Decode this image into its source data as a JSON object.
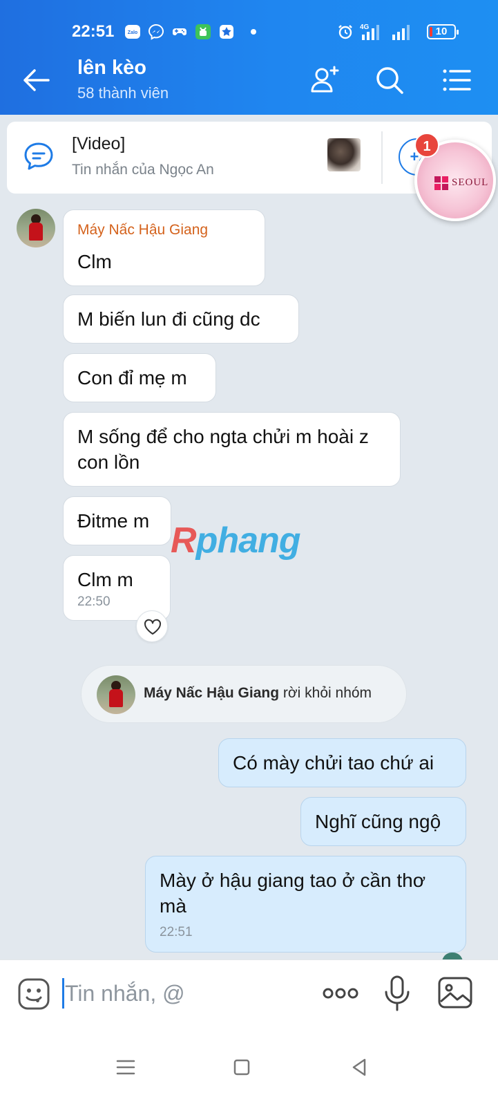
{
  "status_bar": {
    "time": "22:51",
    "battery": "10",
    "network": "4G"
  },
  "header": {
    "title": "lên kèo",
    "subtitle": "58 thành viên"
  },
  "pinned": {
    "title": "[Video]",
    "subtitle": "Tin nhắn của Ngọc An",
    "more_label": "+2",
    "badge": "1",
    "ad_brand": "SEOUL"
  },
  "messages": [
    {
      "sender": "Máy Nấc Hậu Giang",
      "text": "Clm"
    },
    {
      "text": "M biến lun đi cũng dc"
    },
    {
      "text": "Con đỉ mẹ m"
    },
    {
      "text": "M sống để cho ngta chửi m hoài z con lồn"
    },
    {
      "text": "Đitme m"
    },
    {
      "text": "Clm m",
      "time": "22:50"
    }
  ],
  "notice": {
    "name": "Máy Nấc Hậu Giang",
    "action": " rời khỏi nhóm"
  },
  "my_messages": [
    {
      "text": "Có mày chửi tao chứ ai"
    },
    {
      "text": "Nghĩ cũng ngộ"
    },
    {
      "text": "Mày ở hậu giang tao ở cần thơ mà",
      "time": "22:51"
    }
  ],
  "watermark": {
    "r": "R",
    "rest": "phang"
  },
  "input": {
    "placeholder": "Tin nhắn, @"
  },
  "colors": {
    "header": "#1f86f0",
    "accent": "#1e7be6",
    "my_bubble": "#d7ecfd",
    "sender_name": "#d4621c"
  },
  "icons": {
    "header": [
      "back-arrow-icon",
      "add-member-icon",
      "search-icon",
      "menu-list-icon"
    ],
    "input": [
      "emoji-icon",
      "more-dots-icon",
      "microphone-icon",
      "image-icon"
    ]
  }
}
